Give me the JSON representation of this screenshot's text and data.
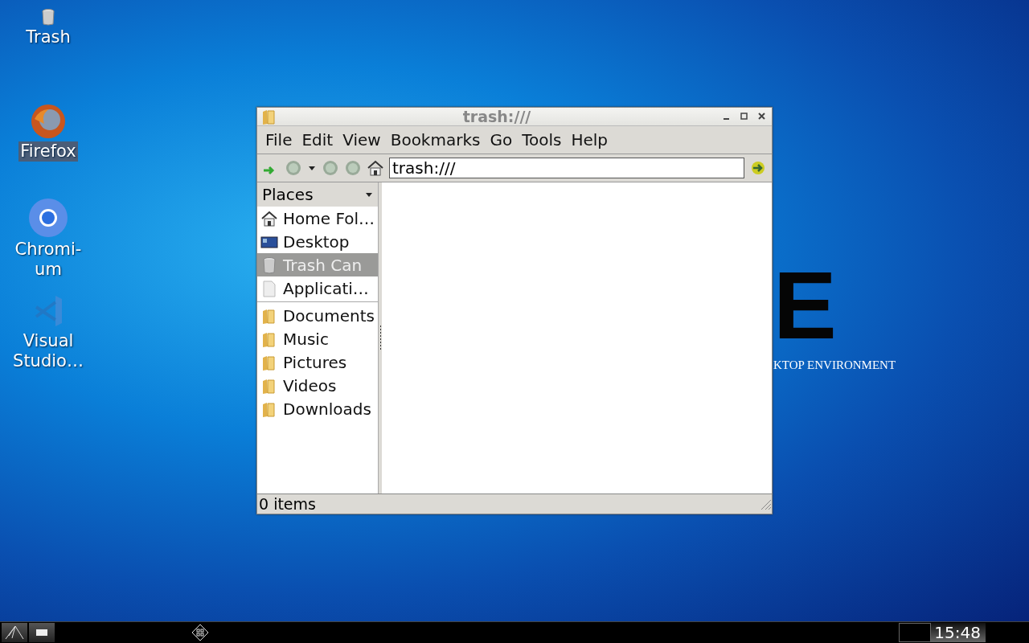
{
  "desktop_icons": [
    {
      "label": "Trash",
      "kind": "trash",
      "selected": false
    },
    {
      "label": "Firefox",
      "kind": "firefox",
      "selected": true
    },
    {
      "label": "Chromi-\num",
      "kind": "chromium",
      "selected": false
    },
    {
      "label": "Visual\nStudio…",
      "kind": "vscode",
      "selected": false
    }
  ],
  "wallpaper": {
    "logo": "E",
    "tagline": "KTOP ENVIRONMENT"
  },
  "window": {
    "title": "trash:///",
    "menu": [
      "File",
      "Edit",
      "View",
      "Bookmarks",
      "Go",
      "Tools",
      "Help"
    ],
    "address": "trash:///",
    "sidebar": {
      "header": "Places",
      "places": [
        {
          "label": "Home Fol…",
          "kind": "home",
          "selected": false
        },
        {
          "label": "Desktop",
          "kind": "desktop",
          "selected": false
        },
        {
          "label": "Trash Can",
          "kind": "trash",
          "selected": true
        },
        {
          "label": "Applicati…",
          "kind": "apps",
          "selected": false
        }
      ],
      "bookmarks": [
        {
          "label": "Documents",
          "kind": "folder",
          "selected": false
        },
        {
          "label": "Music",
          "kind": "folder",
          "selected": false
        },
        {
          "label": "Pictures",
          "kind": "folder",
          "selected": false
        },
        {
          "label": "Videos",
          "kind": "folder",
          "selected": false
        },
        {
          "label": "Downloads",
          "kind": "folder",
          "selected": false
        }
      ]
    },
    "status": "0 items"
  },
  "taskbar": {
    "clock": "15:48"
  }
}
